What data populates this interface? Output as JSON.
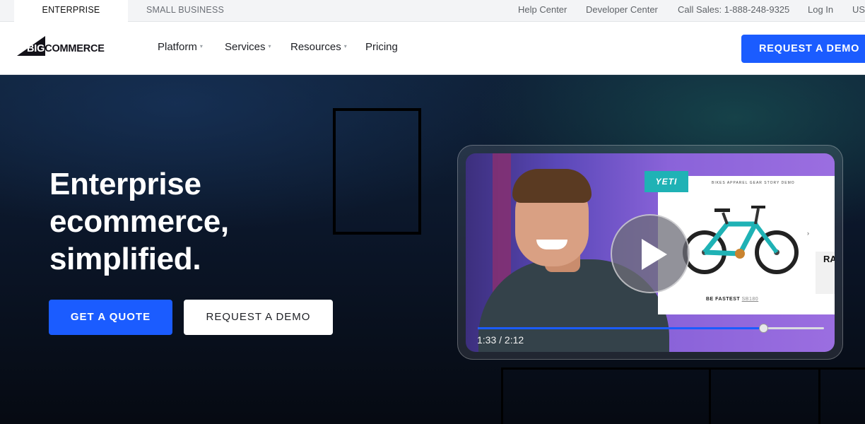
{
  "utility_bar": {
    "tabs": [
      {
        "label": "ENTERPRISE",
        "active": true
      },
      {
        "label": "SMALL BUSINESS",
        "active": false
      }
    ],
    "links": [
      "Help Center",
      "Developer Center",
      "Call Sales: 1-888-248-9325",
      "Log In",
      "US"
    ]
  },
  "nav": {
    "logo_big": "BIG",
    "logo_rest": "COMMERCE",
    "items": [
      {
        "label": "Platform",
        "has_dropdown": true
      },
      {
        "label": "Services",
        "has_dropdown": true
      },
      {
        "label": "Resources",
        "has_dropdown": true
      },
      {
        "label": "Pricing",
        "has_dropdown": false
      }
    ],
    "cta_label": "REQUEST A DEMO",
    "caret": "▾"
  },
  "hero": {
    "title_lines": [
      "Enterprise",
      "ecommerce,",
      "simplified."
    ],
    "primary_button": "GET A QUOTE",
    "secondary_button": "REQUEST A DEMO"
  },
  "video": {
    "brand_badge": "YETI",
    "shop_nav": "BIKES  APPAREL  GEAR  STORY  DEMO",
    "caption_prefix": "BE FASTEST",
    "caption_code": "SB180",
    "side_text": "RA",
    "slide_arrow": "›",
    "current_time": "1:33",
    "total_time": "2:12",
    "time_label": "1:33 / 2:12",
    "progress": 0.825
  },
  "colors": {
    "accent": "#1b5cff",
    "hero_bg": "#0b1629",
    "brand_teal": "#1fb2b5"
  }
}
